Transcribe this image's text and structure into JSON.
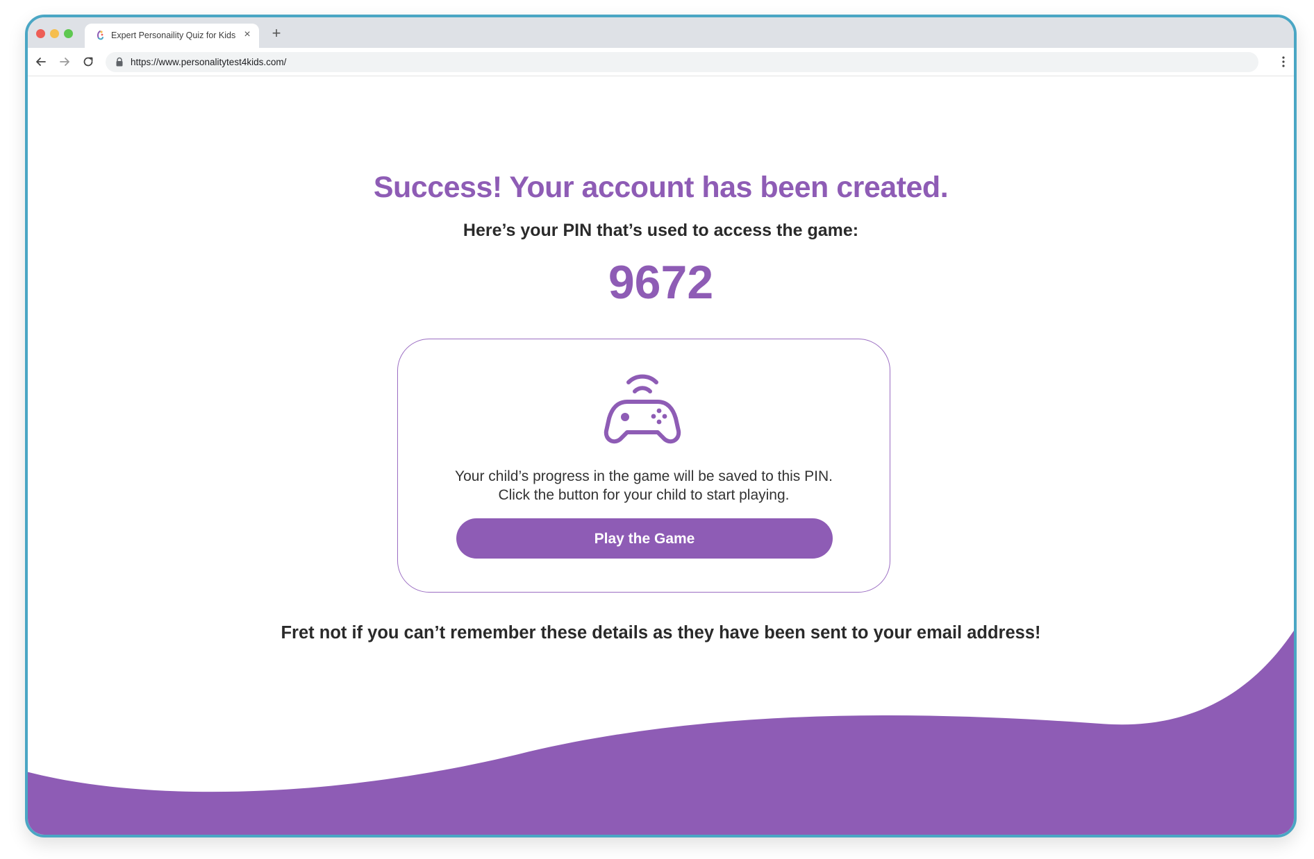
{
  "browser": {
    "tab_title": "Expert Personaility Quiz for Kids",
    "tab_close": "×",
    "new_tab": "+",
    "url": "https://www.personalitytest4kids.com/"
  },
  "page": {
    "headline": "Success! Your account has been created.",
    "subheadline": "Here’s your PIN that’s used to access the game:",
    "pin": "9672",
    "card": {
      "icon": "gamepad-wireless-icon",
      "line1": "Your child’s progress in the game will be saved to this PIN.",
      "line2": "Click the button for your child to start playing.",
      "button_label": "Play the Game"
    },
    "footnote": "Fret not if you can’t remember these details as they have been sent to your email address!"
  },
  "colors": {
    "accent": "#8e5cb5",
    "frame_border": "#4aa6c4",
    "text_dark": "#2a2a2a"
  }
}
